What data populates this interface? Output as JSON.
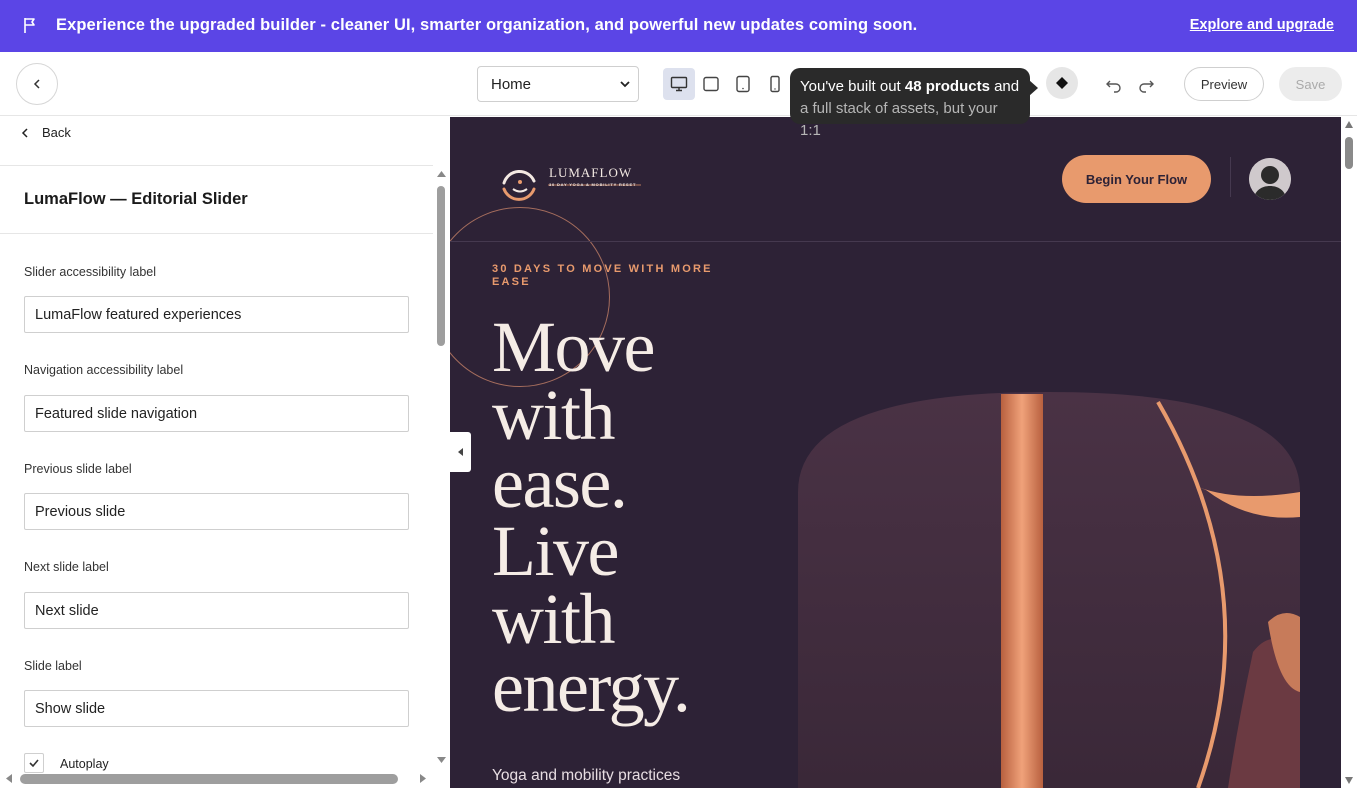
{
  "banner": {
    "message": "Experience the upgraded builder - cleaner UI, smarter organization, and powerful new updates coming soon.",
    "link": "Explore and upgrade",
    "background": "#5b45e6"
  },
  "toolbar": {
    "page_select": "Home",
    "devices": [
      "desktop",
      "tablet-landscape",
      "tablet-portrait",
      "mobile"
    ],
    "active_device": "desktop",
    "tooltip_line1_prefix": "You've built out ",
    "tooltip_line1_bold": "48 products",
    "tooltip_line1_suffix": " and",
    "tooltip_line2": "a full stack of assets, but your 1:1",
    "preview_label": "Preview",
    "save_label": "Save"
  },
  "panel": {
    "back_label": "Back",
    "title": "LumaFlow — Editorial Slider",
    "fields": [
      {
        "label": "Slider accessibility label",
        "value": "LumaFlow featured experiences"
      },
      {
        "label": "Navigation accessibility label",
        "value": "Featured slide navigation"
      },
      {
        "label": "Previous slide label",
        "value": "Previous slide"
      },
      {
        "label": "Next slide label",
        "value": "Next slide"
      },
      {
        "label": "Slide label",
        "value": "Show slide"
      }
    ],
    "autoplay_label": "Autoplay",
    "autoplay_checked": true
  },
  "preview": {
    "logo_name": "LUMAFLOW",
    "logo_tagline": "30 DAY YOGA & MOBILITY RESET",
    "cta": "Begin Your Flow",
    "eyebrow": "30 DAYS TO MOVE WITH MORE EASE",
    "headline_lines": [
      "Move",
      "with",
      "ease.",
      "Live",
      "with",
      "energy."
    ],
    "subtext": "Yoga and mobility practices",
    "accent": "#e89a6d",
    "background": "#2d2236"
  }
}
